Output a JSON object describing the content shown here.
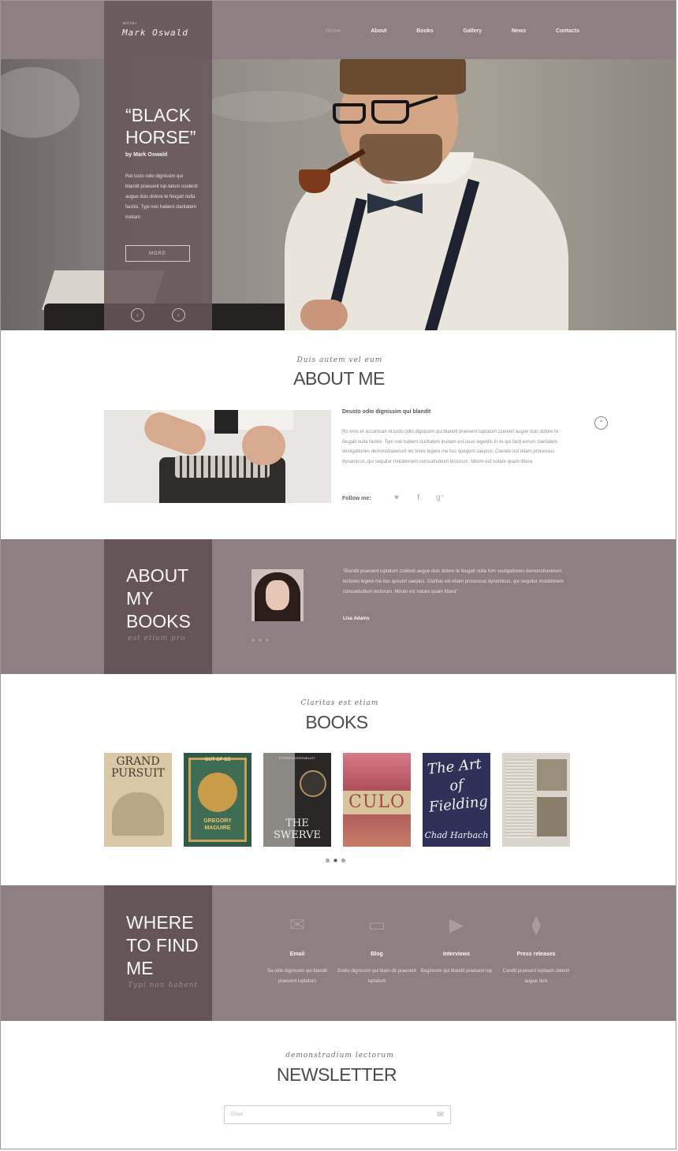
{
  "header": {
    "logo_small": "writer",
    "logo_name": "Mark Oswald",
    "nav": [
      "Home",
      "About",
      "Books",
      "Gallery",
      "News",
      "Contacts"
    ]
  },
  "hero": {
    "title_line1": "“BLACK",
    "title_line2": "HORSE”",
    "byline": "by Mark Oswald",
    "text": "Ret iusto odio dignissim qui blandit praesent lup-tatum ozelenit augue duis dolore te feugait nulla facilisi. Typi non habent claritatem insitam",
    "more_label": "MORE",
    "prev_icon": "chevron-left-icon",
    "next_icon": "chevron-right-icon"
  },
  "about": {
    "script": "Duis autem vel eum",
    "title": "ABOUT ME",
    "heading": "Deusto odio dignissim qui blandit",
    "text": "Ro eros et accumsan et iusto odio dignissim qui blandit praesent luptatum zzelenit augue duis dolore te feugait nulla facilisi. Typi non habent claritatem insitam est usus legentis in iis qui facit eorum claritatem vestigationes demonstraverunt lec tores legere me lius quegunt saepius. Claritas est etiam processus dynamicus, qui sequitur mutationem consuetudium lectorum. Mirum est notare quam littera",
    "follow_label": "Follow me:",
    "social": [
      "twitter-icon",
      "facebook-icon",
      "google-plus-icon"
    ]
  },
  "about_books": {
    "title_lines": [
      "ABOUT",
      "MY",
      "BOOKS"
    ],
    "script": "est etiam pro",
    "quote": "“Blandit praesent luptatum zzelenit augue duis dolore te feugait nulla fom vestigationes demonstraverunt lectores legere me lius quisunt saepius. Claritas est etiam processus dynamicus, qui sequitur mutationem consuetudium lectorum. Mirum est notare quam littera”",
    "author": "Lisa Adams"
  },
  "books": {
    "script": "Claritas est etiam",
    "title": "BOOKS",
    "covers": [
      {
        "title": "GRAND PURSUIT",
        "author": ""
      },
      {
        "title": "OUT OF OZ",
        "author": "GREGORY MAGUIRE"
      },
      {
        "title": "THE SWERVE",
        "author": "STEPHEN GREENBLATT"
      },
      {
        "title": "CULO",
        "author": ""
      },
      {
        "title": "The Art of Fielding",
        "author": "Chad Harbach"
      },
      {
        "title": "",
        "author": ""
      }
    ]
  },
  "find_me": {
    "title_lines": [
      "WHERE",
      "TO FIND",
      "ME"
    ],
    "script": "Typi non habent",
    "items": [
      {
        "icon": "envelope-icon",
        "label": "Email",
        "desc": "Sa odio dignissim qui blandit praesent luptatum"
      },
      {
        "icon": "browser-icon",
        "label": "Blog",
        "desc": "Dodio dignissim qui blam dit praesent luptatum"
      },
      {
        "icon": "video-camera-icon",
        "label": "Interviews",
        "desc": "Beginsom qui blandit praesent lup"
      },
      {
        "icon": "tie-icon",
        "label": "Press releases",
        "desc": "Candit praesent luptaum zelenit augue duis"
      }
    ]
  },
  "newsletter": {
    "script": "demonstradium lectorum",
    "title": "NEWSLETTER",
    "placeholder": "Email",
    "submit_icon": "envelope-icon"
  },
  "colors": {
    "band": "#8d7f82",
    "band_dark": "#655558",
    "text_dark": "#4b4b4b"
  }
}
